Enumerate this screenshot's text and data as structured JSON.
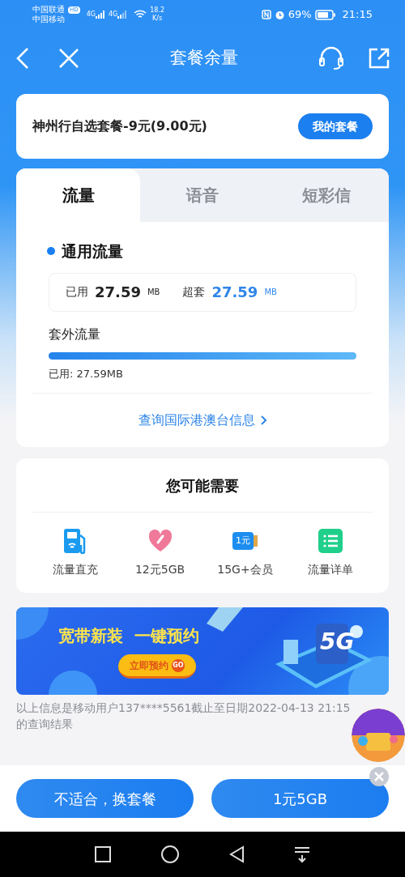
{
  "status_bar": {
    "carrier_1": "中国联通",
    "hd": "HD",
    "carrier_2": "中国移动",
    "net_1": "4G",
    "net_2": "4G",
    "speed": "18.2",
    "speed_unit": "K/s",
    "battery": "69%",
    "time": "21:15"
  },
  "header": {
    "title": "套餐余量"
  },
  "plan": {
    "name": "神州行自选套餐-9元(9.00元)",
    "button": "我的套餐"
  },
  "tabs": [
    {
      "label": "流量",
      "selected": true
    },
    {
      "label": "语音",
      "selected": false
    },
    {
      "label": "短彩信",
      "selected": false
    }
  ],
  "usage": {
    "title": "通用流量",
    "used_label": "已用",
    "used_value": "27.59",
    "used_unit": "MB",
    "over_label": "超套",
    "over_value": "27.59",
    "over_unit": "MB"
  },
  "extra": {
    "title": "套外流量",
    "level": 1,
    "reading": "已用: 27.59MB"
  },
  "intl_link": "查询国际港澳台信息",
  "recommend": {
    "title": "您可能需要",
    "items": [
      {
        "kind": "recharge",
        "label": "流量直充"
      },
      {
        "kind": "heart",
        "label": "12元5GB"
      },
      {
        "kind": "coupon",
        "label": "15G+会员",
        "icon_text": "1元"
      },
      {
        "kind": "list",
        "label": "流量详单"
      }
    ]
  },
  "banner": {
    "headline": "宽带新装  一键预约",
    "button": "立即预约",
    "go": "GO",
    "badge": "5G"
  },
  "footnote": "以上信息是移动用户137****5561截止至日期2022-04-13 21:15的查询结果",
  "actions": [
    {
      "label": "不适合，换套餐"
    },
    {
      "label": "1元5GB"
    }
  ]
}
